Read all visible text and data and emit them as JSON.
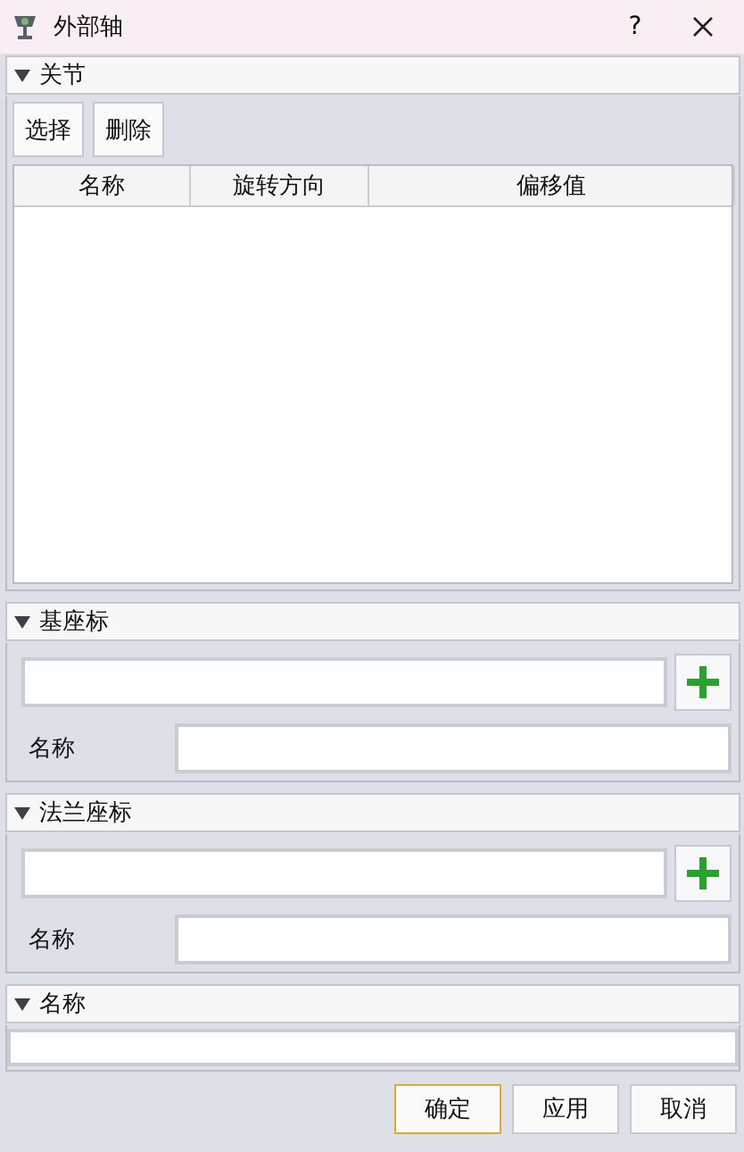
{
  "window": {
    "title": "外部轴",
    "help": "?"
  },
  "joints": {
    "header": "关节",
    "expanded": true,
    "buttons": [
      "选择",
      "删除"
    ],
    "table": {
      "columns": [
        "名称",
        "旋转方向",
        "偏移值"
      ]
    }
  },
  "frames": [
    {
      "header": "基座标",
      "expanded": true,
      "name_label": "名称"
    },
    {
      "header": "法兰座标",
      "expanded": true,
      "name_label": "名称"
    }
  ],
  "name": {
    "header": "名称",
    "expanded": true
  },
  "buttons": [
    {
      "label": "确定",
      "default": true
    },
    {
      "label": "应用",
      "default": false
    },
    {
      "label": "取消",
      "default": false
    }
  ]
}
